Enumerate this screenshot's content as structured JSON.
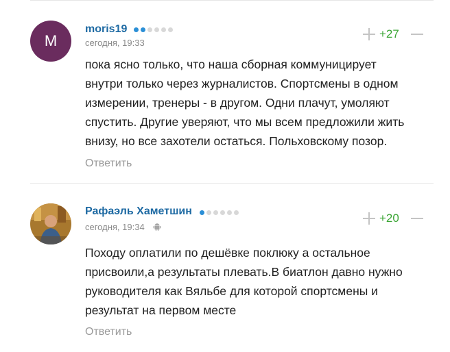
{
  "comments": [
    {
      "avatar_letter": "M",
      "username": "moris19",
      "rating_level": 2,
      "rating_max": 6,
      "time": "сегодня, 19:33",
      "device_icon": null,
      "votes": "+27",
      "lines": [
        "пока ясно только, что наша сборная коммуницирует",
        "внутри только через журналистов. Спортсмены в одном",
        "измерении, тренеры - в другом. Одни плачут, умоляют",
        "спустить. Другие уверяют, что мы всем предложили жить",
        "внизу, но все захотели остаться. Польховскому позор."
      ],
      "reply_label": "Ответить"
    },
    {
      "avatar_letter": "",
      "username": "Рафаэль Хаметшин",
      "rating_level": 1,
      "rating_max": 6,
      "time": "сегодня, 19:34",
      "device_icon": "android-icon",
      "votes": "+20",
      "lines": [
        "Походу оплатили по дешёвке поклюку а остальное",
        "присвоили,а результаты плевать.В биатлон давно нужно",
        "руководителя как Вяльбе для которой спортсмены и",
        "результат на первом месте"
      ],
      "reply_label": "Ответить"
    }
  ],
  "colors": {
    "username": "#1e6aa3",
    "votes_positive": "#3aa534",
    "rating_dot_on": "#2b8fd6",
    "avatar_bg": "#6a2c5e"
  }
}
